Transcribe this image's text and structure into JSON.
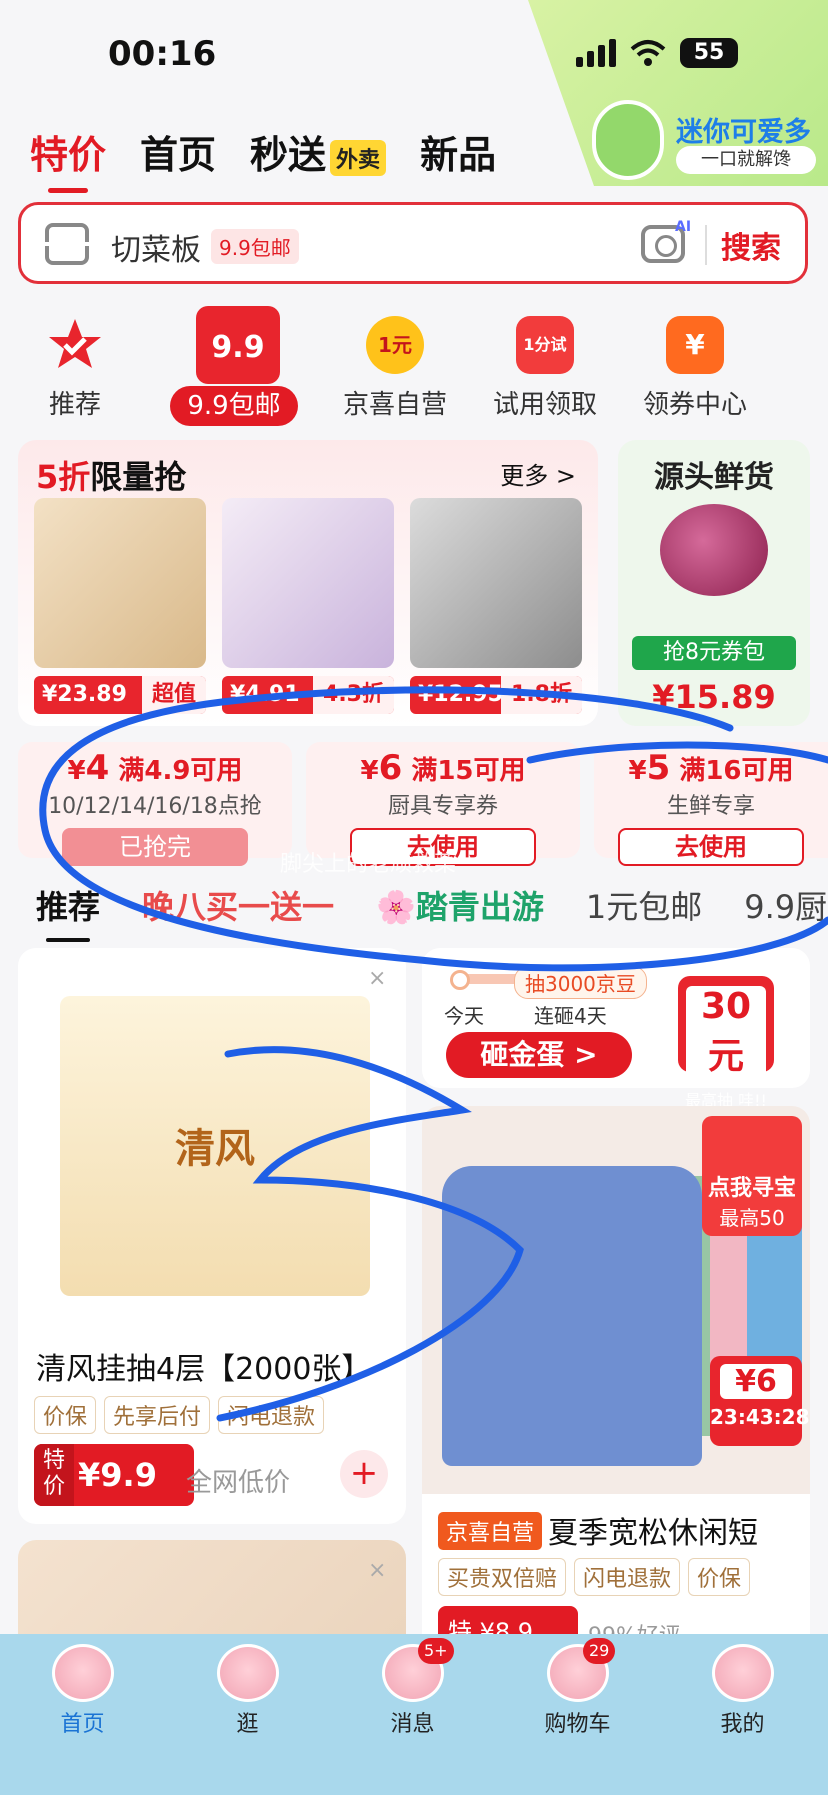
{
  "status": {
    "time": "00:16",
    "battery": "55"
  },
  "promo": {
    "title": "迷你可爱多",
    "subtitle": "一口就解馋"
  },
  "top_tabs": [
    {
      "label": "特价"
    },
    {
      "label": "首页"
    },
    {
      "label": "秒送",
      "tag": "外卖"
    },
    {
      "label": "新品"
    }
  ],
  "search": {
    "query": "切菜板",
    "tag": "9.9包邮",
    "button": "搜索",
    "ai_label": "AI"
  },
  "categories": [
    {
      "label": "推荐",
      "icon": "star-check-icon"
    },
    {
      "label": "9.9包邮",
      "icon_text": "9.9"
    },
    {
      "label": "京喜自营",
      "icon_text": "1元"
    },
    {
      "label": "试用领取",
      "icon_text": "1分试"
    },
    {
      "label": "领券中心",
      "icon_text": "¥"
    }
  ],
  "flash_sale": {
    "title_red": "5折",
    "title_rest": "限量抢",
    "more": "更多 >",
    "items": [
      {
        "price": "¥23.89",
        "tag": "超值"
      },
      {
        "price": "¥4.91",
        "tag": "4.3折"
      },
      {
        "price": "¥12.95",
        "tag": "1.8折"
      }
    ]
  },
  "fresh": {
    "title": "源头鲜货",
    "coupon": "抢8元券包",
    "price": "¥15.89"
  },
  "coupons": [
    {
      "amount": "4",
      "cond": "满4.9可用",
      "desc": "10/12/14/16/18点抢",
      "button": "已抢完"
    },
    {
      "amount": "6",
      "cond": "满15可用",
      "desc": "厨具专享券",
      "button": "去使用"
    },
    {
      "amount": "5",
      "cond": "满16可用",
      "desc": "生鲜专享",
      "button": "去使用"
    }
  ],
  "watermark": "脚尖上的老顽救菜",
  "feed_tabs": [
    {
      "label": "推荐"
    },
    {
      "label": "晚八买一送一"
    },
    {
      "label": "🌸踏青出游"
    },
    {
      "label": "1元包邮"
    },
    {
      "label": "9.9厨具"
    }
  ],
  "product_left": {
    "brand": "清风",
    "title": "清风挂抽4层【2000张】",
    "tags": [
      "价保",
      "先享后付",
      "闪电退款"
    ],
    "badge": "特价",
    "price": "¥9.9",
    "note": "全网低价",
    "close": "×"
  },
  "egg": {
    "pill": "抽3000京豆",
    "today": "今天",
    "streak": "连砸4天",
    "button": "砸金蛋 >",
    "prize": "30元",
    "prize_sub": "最高抽 哇!!"
  },
  "tshirt": {
    "treasure_1": "点我寻宝",
    "treasure_2": "最高50",
    "timer_price": "¥6",
    "timer": "23:43:28"
  },
  "product_right": {
    "tag": "京喜自营",
    "title": "夏季宽松休闲短",
    "tags": [
      "买贵双倍赔",
      "闪电退款",
      "价保"
    ],
    "badge": "特 ¥8.9",
    "good_rate": "99%好评"
  },
  "bottom_nav": [
    {
      "label": "首页"
    },
    {
      "label": "逛"
    },
    {
      "label": "消息",
      "badge": "5+"
    },
    {
      "label": "购物车",
      "badge": "29"
    },
    {
      "label": "我的"
    }
  ],
  "colors": {
    "brand_red": "#e21b24",
    "nav_bg": "#a9d8ec",
    "scribble_blue": "#1f5fe6"
  }
}
